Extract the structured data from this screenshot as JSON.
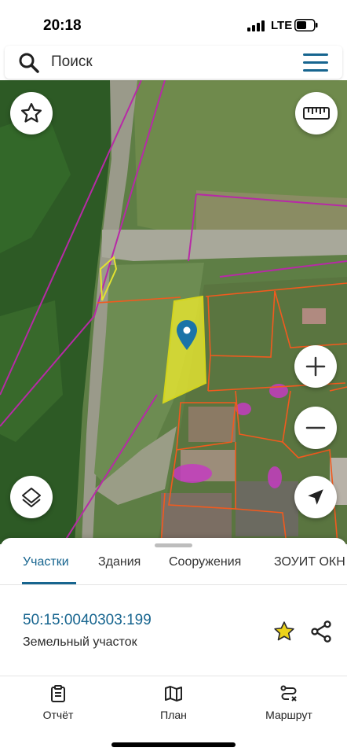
{
  "status_bar": {
    "time": "20:18",
    "network": "LTE"
  },
  "search": {
    "placeholder": "Поиск"
  },
  "icons": {
    "search": "search-icon",
    "menu": "hamburger-menu-icon",
    "favorite": "star-outline-icon",
    "ruler": "ruler-icon",
    "zoom_in": "plus-icon",
    "zoom_out": "minus-icon",
    "layers": "layers-icon",
    "locate": "navigation-arrow-icon",
    "pin": "map-pin-icon",
    "bookmark": "star-filled-icon",
    "share": "share-icon",
    "report": "clipboard-icon",
    "plan": "map-icon",
    "route": "route-icon"
  },
  "tabs": [
    {
      "label": "Участки",
      "active": true
    },
    {
      "label": "Здания",
      "active": false
    },
    {
      "label": "Сооружения",
      "active": false
    },
    {
      "label": "ЗОУИТ ОКН",
      "active": false
    }
  ],
  "parcel": {
    "cadastral_number": "50:15:0040303:199",
    "type": "Земельный участок"
  },
  "bottom_nav": [
    {
      "label": "Отчёт"
    },
    {
      "label": "План"
    },
    {
      "label": "Маршрут"
    }
  ],
  "colors": {
    "accent": "#17658f",
    "parcel_fill": "#e2e231",
    "parcel_border": "#f25a1e",
    "zone_border": "#b72aa6",
    "star": "#ecd21a"
  }
}
